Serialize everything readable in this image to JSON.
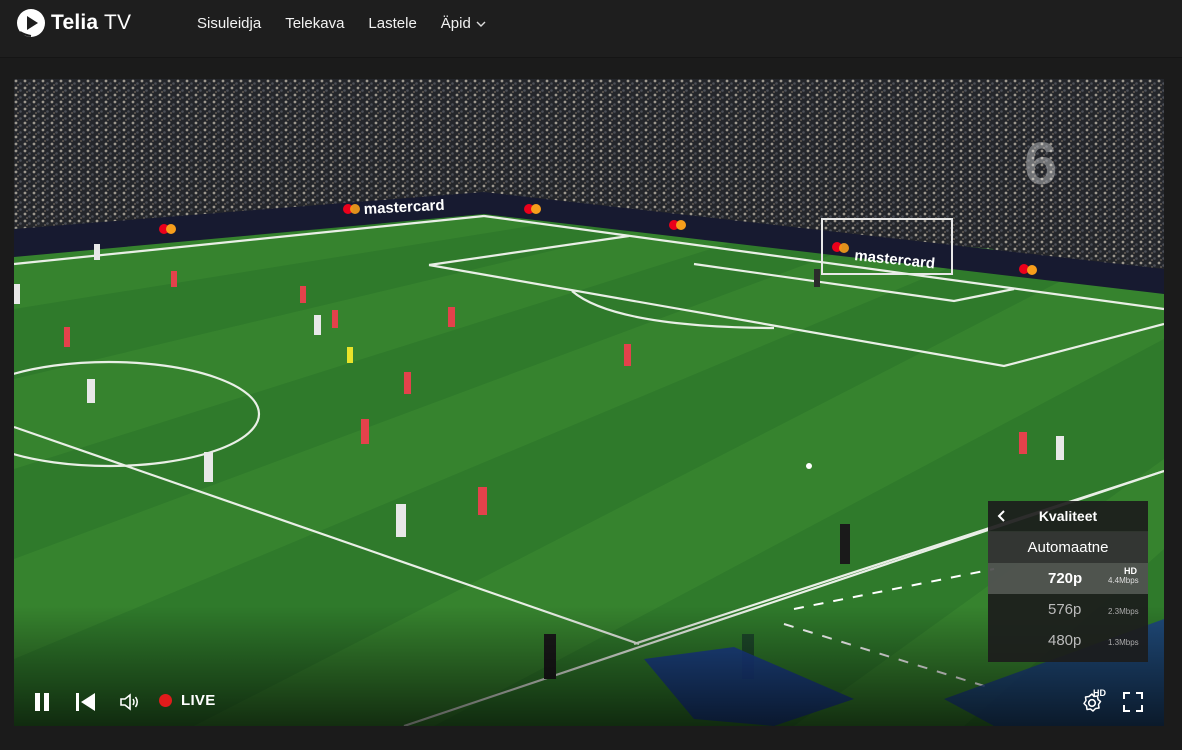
{
  "brand": {
    "name_bold": "Telia",
    "name_rest": " TV"
  },
  "nav": [
    {
      "label": "Sisuleidja"
    },
    {
      "label": "Telekava"
    },
    {
      "label": "Lastele"
    },
    {
      "label": "Äpid"
    }
  ],
  "video": {
    "broadcast_sponsor": "mastercard",
    "channel_logo": "6"
  },
  "controls": {
    "live_label": "LIVE",
    "settings_badge": "HD"
  },
  "quality_menu": {
    "title": "Kvaliteet",
    "auto_label": "Automaatne",
    "options": [
      {
        "resolution": "720p",
        "bitrate": "4.4Mbps",
        "badge": "HD",
        "selected": true
      },
      {
        "resolution": "576p",
        "bitrate": "2.3Mbps",
        "badge": "",
        "selected": false
      },
      {
        "resolution": "480p",
        "bitrate": "1.3Mbps",
        "badge": "",
        "selected": false
      }
    ]
  },
  "colors": {
    "live_dot": "#e01b1b",
    "topbar_bg": "#1e1e1e",
    "pitch_green": "#2f7a2b"
  }
}
